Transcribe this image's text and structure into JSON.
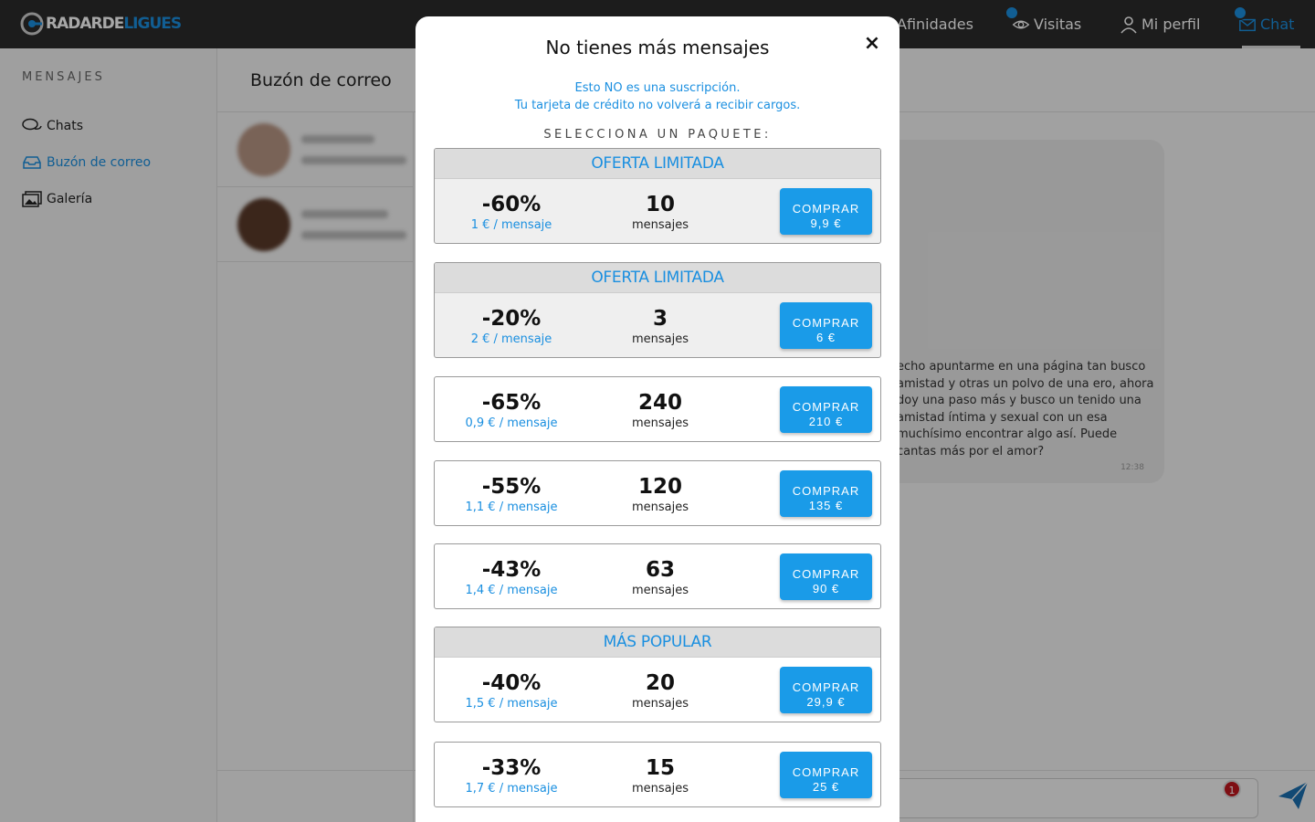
{
  "app": {
    "logo_main": "RADARDE",
    "logo_accent": "LIGUES"
  },
  "nav": {
    "afinidades": "Afinidades",
    "visitas": "Visitas",
    "mi_perfil": "Mi perfil",
    "chat": "Chat"
  },
  "sidebar": {
    "title": "MENSAJES",
    "items": [
      {
        "label": "Chats",
        "icon": "chats-icon"
      },
      {
        "label": "Buzón de correo",
        "icon": "inbox-icon",
        "active": true
      },
      {
        "label": "Galería",
        "icon": "gallery-icon"
      }
    ]
  },
  "main": {
    "title": "Buzón de correo",
    "message": {
      "text": "echo apuntarme en una página tan busco amistad y otras un polvo de una ero, ahora doy una paso más y busco un tenido una amistad íntima y sexual con un esa muchísimo encontrar algo así. Puede cantas más por el amor?",
      "time": "12:38"
    },
    "composer_badge": "1"
  },
  "modal": {
    "title": "No tienes más mensajes",
    "close": "×",
    "notice_line1": "Esto NO es una suscripción.",
    "notice_line2": "Tu tarjeta de crédito no volverá a recibir cargos.",
    "select_label": "SELECCIONA UN PAQUETE:",
    "buy_label": "COMPRAR",
    "unit_label": "mensajes",
    "packages": [
      {
        "tag": "OFERTA LIMITADA",
        "discount": "-60%",
        "per": "1 € / mensaje",
        "qty": "10",
        "price": "9,9 €"
      },
      {
        "tag": "OFERTA LIMITADA",
        "discount": "-20%",
        "per": "2 € / mensaje",
        "qty": "3",
        "price": "6 €"
      },
      {
        "tag": "",
        "discount": "-65%",
        "per": "0,9 € / mensaje",
        "qty": "240",
        "price": "210 €"
      },
      {
        "tag": "",
        "discount": "-55%",
        "per": "1,1 € / mensaje",
        "qty": "120",
        "price": "135 €"
      },
      {
        "tag": "",
        "discount": "-43%",
        "per": "1,4 € / mensaje",
        "qty": "63",
        "price": "90 €"
      },
      {
        "tag": "MÁS POPULAR",
        "discount": "-40%",
        "per": "1,5 € / mensaje",
        "qty": "20",
        "price": "29,9 €"
      },
      {
        "tag": "",
        "discount": "-33%",
        "per": "1,7 € / mensaje",
        "qty": "15",
        "price": "25 €"
      }
    ]
  },
  "colors": {
    "accent": "#1a8fe0",
    "button": "#1a9be8",
    "topbar": "#2b2b2b",
    "badge": "#c0161e"
  }
}
